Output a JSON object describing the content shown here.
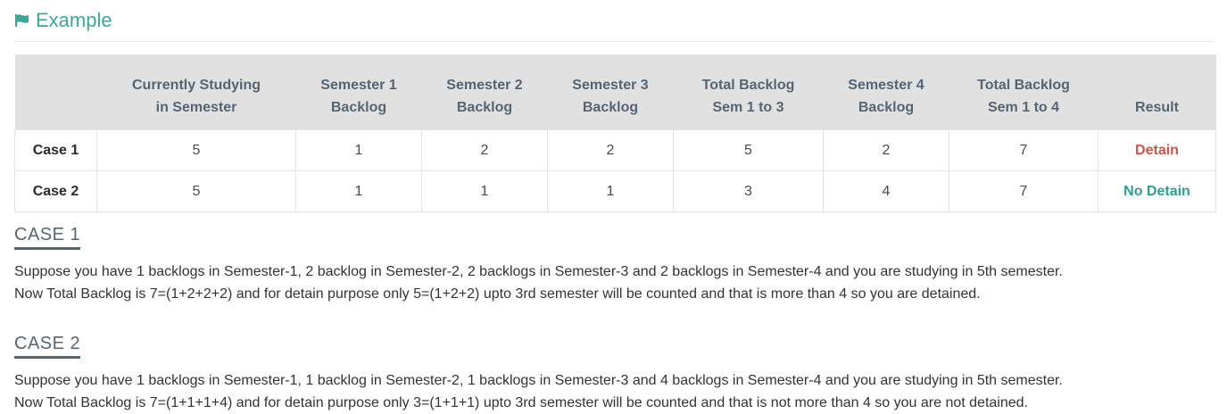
{
  "header": {
    "title": "Example",
    "icon": "flag-icon",
    "accent_color": "#3aa79a"
  },
  "table": {
    "columns": [
      "",
      "Currently Studying in Semester",
      "Semester 1 Backlog",
      "Semester 2 Backlog",
      "Semester 3 Backlog",
      "Total Backlog Sem 1 to 3",
      "Semester 4 Backlog",
      "Total Backlog Sem 1 to 4",
      "Result"
    ],
    "rows": [
      {
        "label": "Case 1",
        "values": [
          "5",
          "1",
          "2",
          "2",
          "5",
          "2",
          "7"
        ],
        "result": "Detain",
        "result_color": "#c9544a"
      },
      {
        "label": "Case 2",
        "values": [
          "5",
          "1",
          "1",
          "1",
          "3",
          "4",
          "7"
        ],
        "result": "No Detain",
        "result_color": "#2e9e8f"
      }
    ]
  },
  "cases": [
    {
      "heading": "CASE 1",
      "line1": "Suppose you have 1 backlogs in Semester-1, 2 backlog in Semester-2, 2 backlogs in Semester-3 and 2 backlogs in Semester-4 and you are studying in 5th semester.",
      "line2": "Now Total Backlog is 7=(1+2+2+2) and for detain purpose only 5=(1+2+2) upto 3rd semester will be counted and that is more than 4 so you are detained."
    },
    {
      "heading": "CASE 2",
      "line1": "Suppose you have 1 backlogs in Semester-1, 1 backlog in Semester-2, 1 backlogs in Semester-3 and 4 backlogs in Semester-4 and you are studying in 5th semester.",
      "line2": "Now Total Backlog is 7=(1+1+1+4) and for detain purpose only 3=(1+1+1) upto 3rd semester will be counted and that is not more than 4 so you are not detained."
    }
  ]
}
